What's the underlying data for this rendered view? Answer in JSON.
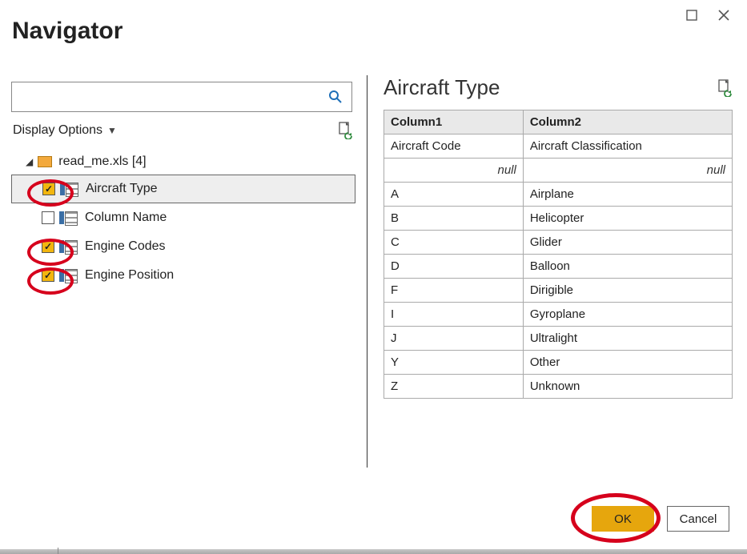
{
  "title": "Navigator",
  "search": {
    "value": "",
    "placeholder": ""
  },
  "display_options": {
    "label": "Display Options"
  },
  "file": {
    "name": "read_me.xls [4]"
  },
  "nodes": [
    {
      "label": "Aircraft Type",
      "checked": true
    },
    {
      "label": "Column Name",
      "checked": false
    },
    {
      "label": "Engine Codes",
      "checked": true
    },
    {
      "label": "Engine Position",
      "checked": true
    }
  ],
  "preview": {
    "title": "Aircraft Type",
    "columns": [
      "Column1",
      "Column2"
    ],
    "rows": [
      {
        "c1": "Aircraft Code",
        "c2": "Aircraft Classification"
      },
      {
        "c1": "null",
        "c2": "null",
        "null_row": true
      },
      {
        "c1": "A",
        "c2": "Airplane"
      },
      {
        "c1": "B",
        "c2": "Helicopter"
      },
      {
        "c1": "C",
        "c2": "Glider"
      },
      {
        "c1": "D",
        "c2": "Balloon"
      },
      {
        "c1": "F",
        "c2": "Dirigible"
      },
      {
        "c1": "I",
        "c2": "Gyroplane"
      },
      {
        "c1": "J",
        "c2": "Ultralight"
      },
      {
        "c1": "Y",
        "c2": "Other"
      },
      {
        "c1": "Z",
        "c2": "Unknown"
      }
    ]
  },
  "buttons": {
    "ok": "OK",
    "cancel": "Cancel"
  }
}
